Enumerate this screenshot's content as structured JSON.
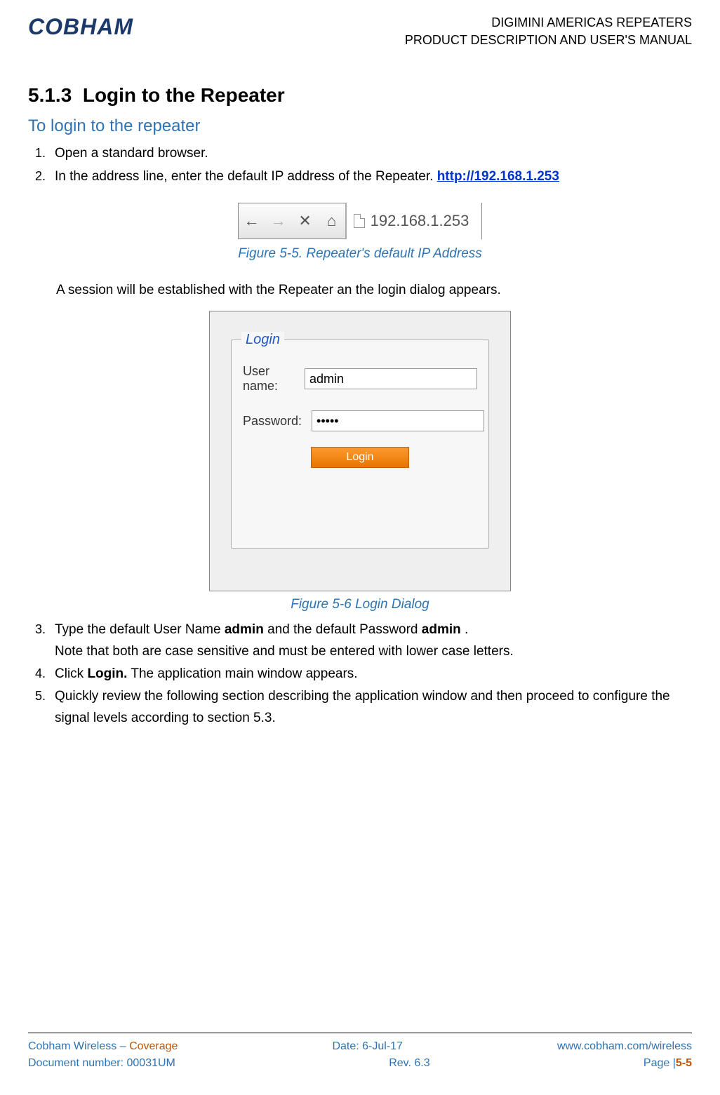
{
  "header": {
    "logo": "COBHAM",
    "line1": "DIGIMINI AMERICAS REPEATERS",
    "line2": "PRODUCT DESCRIPTION AND USER'S MANUAL"
  },
  "section": {
    "number": "5.1.3",
    "title": "Login to the Repeater"
  },
  "subhead": "To login to the repeater",
  "steps": {
    "s1": "Open a standard browser.",
    "s2_pre": "In the address line, enter the default IP address of the Repeater. ",
    "s2_link": "http://192.168.1.253",
    "s3_pre": "Type the default User Name ",
    "s3_b1": "admin",
    "s3_mid": " and the default Password ",
    "s3_b2": "admin",
    "s3_post": ".",
    "s3_note": "Note that both are case sensitive and must be entered with lower case letters.",
    "s4_pre": "Click ",
    "s4_bold": "Login.",
    "s4_post": " The application main window appears.",
    "s5": "Quickly review the following section describing the application window and then proceed to configure the signal levels according to section 5.3."
  },
  "address_bar": {
    "url": "192.168.1.253"
  },
  "captions": {
    "fig5": "Figure 5-5. Repeater's default IP Address",
    "fig6": "Figure 5-6 Login Dialog"
  },
  "session_note": "A session will be established with the Repeater an the login dialog appears.",
  "login_dialog": {
    "title": "Login",
    "user_label": "User name:",
    "pass_label": "Password:",
    "user_value": "admin",
    "pass_value": "•••••",
    "button": "Login"
  },
  "footer": {
    "company": "Cobham Wireless",
    "dash": " – ",
    "coverage": "Coverage",
    "date": "Date: 6-Jul-17",
    "url": "www.cobham.com/wireless",
    "docnum": "Document number: 00031UM",
    "rev": "Rev. 6.3",
    "page_label": "Page |",
    "page_num": "5-5"
  }
}
